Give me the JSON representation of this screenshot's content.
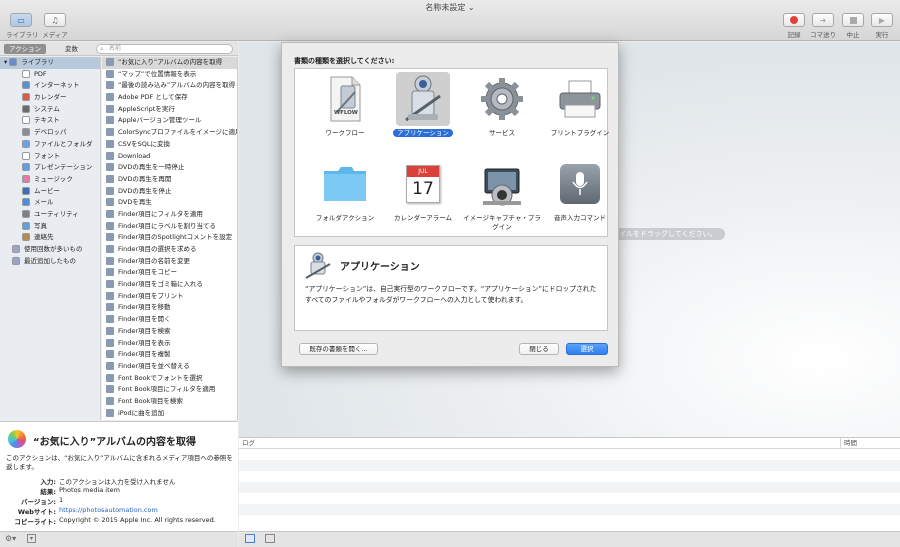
{
  "window": {
    "title": "名称未設定"
  },
  "toolbar": {
    "library_label": "ライブラリ",
    "media_label": "メディア",
    "record_label": "記録",
    "step_label": "コマ送り",
    "stop_label": "中止",
    "run_label": "実行"
  },
  "sidebar": {
    "tab_actions": "アクション",
    "tab_variables": "変数",
    "search_placeholder": "名前",
    "categories": [
      {
        "label": "ライブラリ",
        "color": "#6b8bc9"
      },
      {
        "label": "PDF",
        "color": "#ffffff"
      },
      {
        "label": "インターネット",
        "color": "#5a8fd6"
      },
      {
        "label": "カレンダー",
        "color": "#e05a4c"
      },
      {
        "label": "システム",
        "color": "#6a6a6a"
      },
      {
        "label": "テキスト",
        "color": "#ffffff"
      },
      {
        "label": "デベロッパ",
        "color": "#8a8f98"
      },
      {
        "label": "ファイルとフォルダ",
        "color": "#6aa4e8"
      },
      {
        "label": "フォント",
        "color": "#ffffff"
      },
      {
        "label": "プレゼンテーション",
        "color": "#5f9ee0"
      },
      {
        "label": "ミュージック",
        "color": "#e57aa5"
      },
      {
        "label": "ムービー",
        "color": "#3f6fb5"
      },
      {
        "label": "メール",
        "color": "#4c8fe0"
      },
      {
        "label": "ユーティリティ",
        "color": "#7a7f88"
      },
      {
        "label": "写真",
        "color": "#5ea0d8"
      },
      {
        "label": "連絡先",
        "color": "#b58a55"
      },
      {
        "label": "使用回数が多いもの",
        "color": "#9aa5c8"
      },
      {
        "label": "最近追加したもの",
        "color": "#9aa5c8"
      }
    ],
    "actions": [
      "“お気に入り”アルバムの内容を取得",
      "“マップ”で位置情報を表示",
      "“最後の読み込み”アルバムの内容を取得",
      "Adobe PDF として保存",
      "AppleScriptを実行",
      "Appleバージョン管理ツール",
      "ColorSyncプロファイルをイメージに適用",
      "CSVをSQLに変換",
      "Download",
      "DVDの再生を一時停止",
      "DVDの再生を再開",
      "DVDの再生を停止",
      "DVDを再生",
      "Finder項目にフィルタを適用",
      "Finder項目にラベルを割り当てる",
      "Finder項目のSpotlightコメントを設定",
      "Finder項目の選択を求める",
      "Finder項目の名前を変更",
      "Finder項目をコピー",
      "Finder項目をゴミ箱に入れる",
      "Finder項目をプリント",
      "Finder項目を移動",
      "Finder項目を開く",
      "Finder項目を検索",
      "Finder項目を表示",
      "Finder項目を複製",
      "Finder項目を並べ替える",
      "Font Bookでフォントを選択",
      "Font Book項目にフィルタを適用",
      "Font Book項目を検索",
      "iPodに曲を追加"
    ]
  },
  "description": {
    "title": "“お気に入り”アルバムの内容を取得",
    "text": "このアクションは、“お気に入り”アルバムに含まれるメディア項目への参照を返します。",
    "rows": [
      {
        "key": "入力:",
        "value": "このアクションは入力を受け入れません"
      },
      {
        "key": "結果:",
        "value": "Photos media item"
      },
      {
        "key": "バージョン:",
        "value": "1"
      },
      {
        "key": "Webサイト:",
        "value": "https://photosautomation.com"
      },
      {
        "key": "コピーライト:",
        "value": "Copyright © 2015 Apple Inc. All rights reserved."
      }
    ]
  },
  "workflow": {
    "drop_hint": "イルをドラッグしてください。"
  },
  "log": {
    "log_header": "ログ",
    "time_header": "時間"
  },
  "dialog": {
    "prompt": "書類の種類を選択してください:",
    "types": [
      {
        "label": "ワークフロー",
        "icon": "workflow-icon"
      },
      {
        "label": "アプリケーション",
        "icon": "application-icon"
      },
      {
        "label": "サービス",
        "icon": "service-gear-icon"
      },
      {
        "label": "プリントプラグイン",
        "icon": "printer-icon"
      },
      {
        "label": "フォルダアクション",
        "icon": "folder-icon"
      },
      {
        "label": "カレンダーアラーム",
        "icon": "calendar-icon"
      },
      {
        "label": "イメージキャプチャ・プラグイン",
        "icon": "image-capture-icon"
      },
      {
        "label": "音声入力コマンド",
        "icon": "microphone-icon"
      }
    ],
    "workflow_badge": "WFLOW",
    "calendar_month": "JUL",
    "calendar_day": "17",
    "selected_title": "アプリケーション",
    "selected_text": "“アプリケーション”は、自己実行型のワークフローです。“アプリケーション”にドロップされたすべてのファイルやフォルダがワークフローへの入力として使われます。",
    "open_button": "既存の書類を開く...",
    "close_button": "閉じる",
    "choose_button": "選択"
  }
}
